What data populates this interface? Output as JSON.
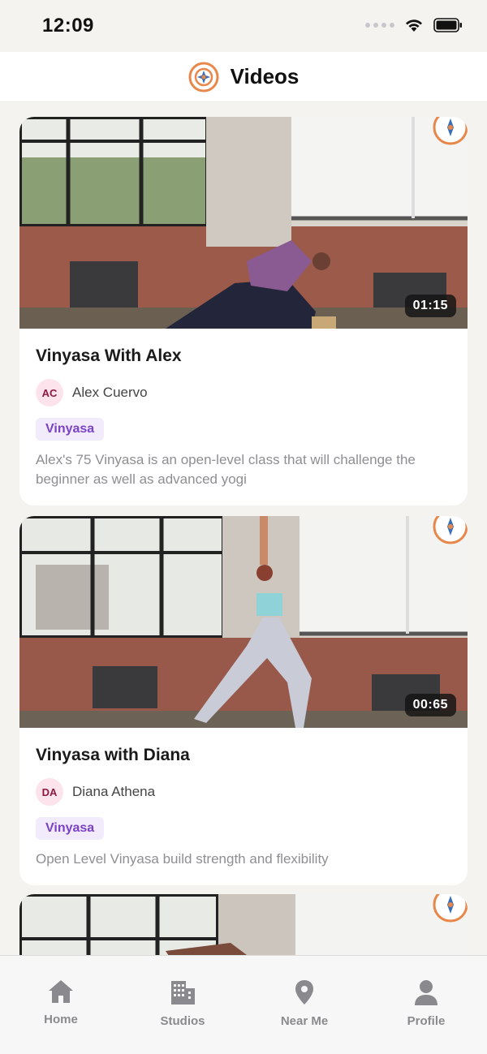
{
  "status_bar": {
    "time": "12:09"
  },
  "header": {
    "title": "Videos",
    "logo_icon": "mandala-logo-icon"
  },
  "videos": [
    {
      "duration": "01:15",
      "title": "Vinyasa With Alex",
      "instructor_initials": "AC",
      "instructor_name": "Alex Cuervo",
      "tag": "Vinyasa",
      "description": "Alex's 75 Vinyasa is an open-level class that will challenge the beginner as well as advanced yogi"
    },
    {
      "duration": "00:65",
      "title": "Vinyasa with Diana",
      "instructor_initials": "DA",
      "instructor_name": "Diana Athena",
      "tag": "Vinyasa",
      "description": "Open Level Vinyasa build strength and flexibility"
    }
  ],
  "tabbar": {
    "items": [
      {
        "label": "Home",
        "icon": "home-icon"
      },
      {
        "label": "Studios",
        "icon": "building-icon"
      },
      {
        "label": "Near Me",
        "icon": "location-pin-icon"
      },
      {
        "label": "Profile",
        "icon": "person-icon"
      }
    ]
  },
  "colors": {
    "accent_orange": "#e8874a",
    "accent_blue": "#3a6fb5",
    "tag_purple": "#7a42c6",
    "avatar_bg": "#fde4ec",
    "tab_grey": "#8a8a8e"
  }
}
